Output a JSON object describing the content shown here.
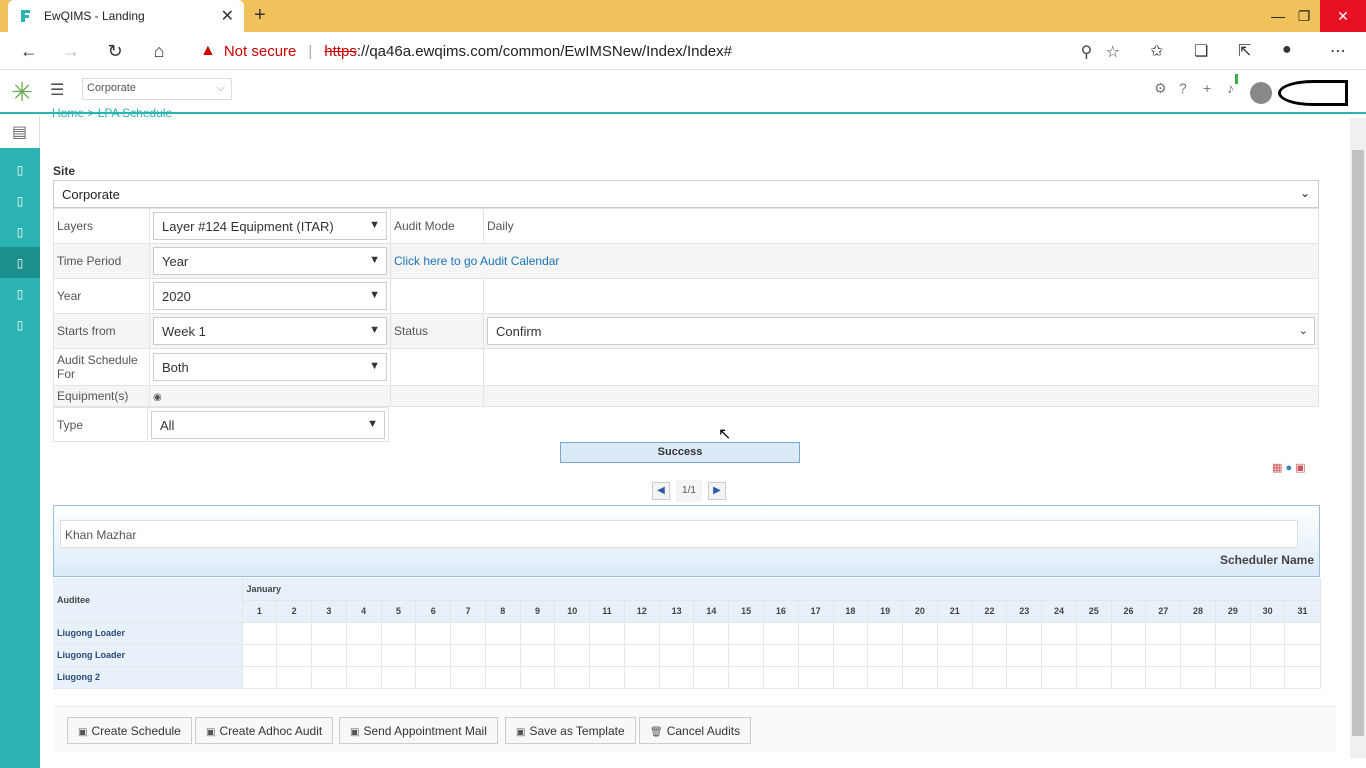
{
  "browser": {
    "tab_title": "EwQIMS - Landing",
    "not_secure": "Not secure",
    "url_https": "https",
    "url_rest": "://qa46a.ewqims.com/common/EwIMSNew/Index/Index#"
  },
  "header": {
    "site_selector": "Corporate"
  },
  "breadcrumb": {
    "home": "Home",
    "current": "LPA Schedule"
  },
  "form": {
    "site_label": "Site",
    "site_value": "Corporate",
    "layers_label": "Layers",
    "layers_value": "Layer #124 Equipment (ITAR)",
    "audit_mode_label": "Audit Mode",
    "audit_mode_value": "Daily",
    "time_period_label": "Time Period",
    "time_period_value": "Year",
    "calendar_link": "Click here to go Audit Calendar",
    "year_label": "Year",
    "year_value": "2020",
    "starts_from_label": "Starts from",
    "starts_from_value": "Week 1",
    "status_label": "Status",
    "status_value": "Confirm",
    "schedule_for_label": "Audit Schedule For",
    "schedule_for_value": "Both",
    "equipments_label": "Equipment(s)",
    "type_label": "Type",
    "type_value": "All"
  },
  "success_message": "Success",
  "pager": {
    "text": "1/1"
  },
  "scheduler": {
    "name_value": "Khan Mazhar",
    "name_label": "Scheduler Name"
  },
  "grid": {
    "auditee_header": "Auditee",
    "month": "January",
    "days": [
      "1",
      "2",
      "3",
      "4",
      "5",
      "6",
      "7",
      "8",
      "9",
      "10",
      "11",
      "12",
      "13",
      "14",
      "15",
      "16",
      "17",
      "18",
      "19",
      "20",
      "21",
      "22",
      "23",
      "24",
      "25",
      "26",
      "27",
      "28",
      "29",
      "30",
      "31"
    ],
    "rows": [
      "Liugong Loader",
      "Liugong Loader",
      "Liugong 2"
    ]
  },
  "actions": {
    "create_schedule": "Create Schedule",
    "create_adhoc": "Create Adhoc Audit",
    "send_mail": "Send Appointment Mail",
    "save_template": "Save as Template",
    "cancel_audits": "Cancel Audits"
  },
  "colors": {
    "accent": "#2ab3b0",
    "titlebar": "#f1c15c",
    "link": "#1a73b8"
  }
}
